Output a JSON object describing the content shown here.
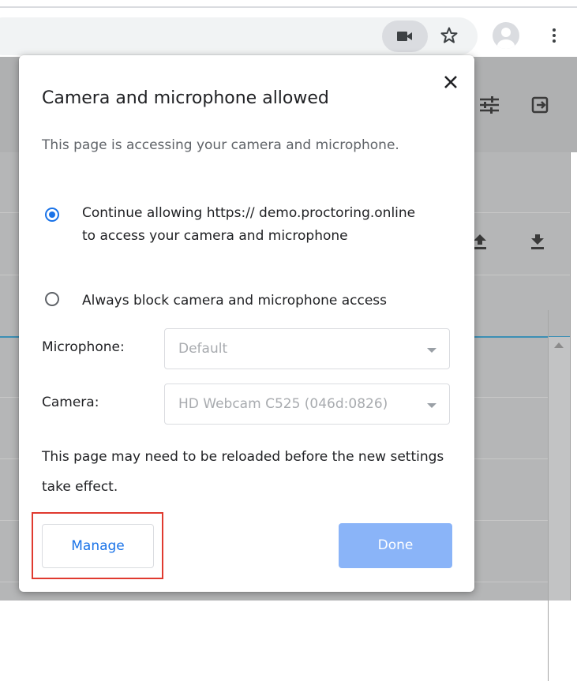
{
  "browser": {
    "toolbar_icons": [
      "camera-icon",
      "star-icon",
      "account-icon",
      "more-menu-icon"
    ]
  },
  "dialog": {
    "title": "Camera and microphone allowed",
    "description": "This page is accessing your camera and microphone.",
    "options": [
      {
        "label": "Continue allowing https:// demo.proctoring.online to access your camera and microphone",
        "selected": true
      },
      {
        "label": "Always block camera and microphone access",
        "selected": false
      }
    ],
    "microphone": {
      "label": "Microphone:",
      "value": "Default"
    },
    "camera": {
      "label": "Camera:",
      "value": "HD Webcam C525 (046d:0826)"
    },
    "note": "This page may need to be reloaded before the new settings take effect.",
    "manage_label": "Manage",
    "done_label": "Done"
  },
  "colors": {
    "accent": "#1a73e8",
    "done_button": "#8ab4f8",
    "highlight_outline": "#e03a2f"
  }
}
